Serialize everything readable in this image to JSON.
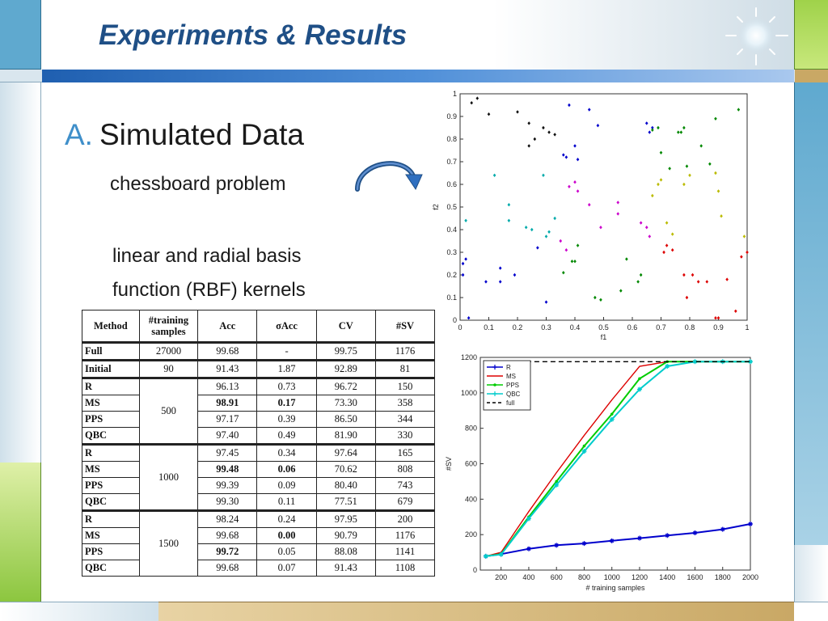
{
  "slide": {
    "title": "Experiments & Results",
    "heading_letter": "A.",
    "heading": "Simulated Data",
    "subtitle1": "chessboard problem",
    "subtitle2_line1": "linear and radial basis",
    "subtitle2_line2": "function (RBF) kernels"
  },
  "colors": {
    "title": "#1f4f86",
    "accent_blue": "#3f8fca",
    "frame_teal": "#5fa9cf",
    "frame_green": "#8cc63f",
    "frame_tan": "#c9a865"
  },
  "table": {
    "headers": [
      "Method",
      "#training samples",
      "Acc",
      "σAcc",
      "CV",
      "#SV"
    ],
    "top_rows": [
      {
        "method": "Full",
        "samples": "27000",
        "acc": "99.68",
        "sigma": "-",
        "cv": "99.75",
        "sv": "1176"
      },
      {
        "method": "Initial",
        "samples": "90",
        "acc": "91.43",
        "sigma": "1.87",
        "cv": "92.89",
        "sv": "81"
      }
    ],
    "groups": [
      {
        "samples": "500",
        "rows": [
          {
            "method": "R",
            "acc": "96.13",
            "sigma": "0.73",
            "cv": "96.72",
            "sv": "150"
          },
          {
            "method": "MS",
            "acc": "98.91",
            "sigma": "0.17",
            "cv": "73.30",
            "sv": "358"
          },
          {
            "method": "PPS",
            "acc": "97.17",
            "sigma": "0.39",
            "cv": "86.50",
            "sv": "344"
          },
          {
            "method": "QBC",
            "acc": "97.40",
            "sigma": "0.49",
            "cv": "81.90",
            "sv": "330"
          }
        ]
      },
      {
        "samples": "1000",
        "rows": [
          {
            "method": "R",
            "acc": "97.45",
            "sigma": "0.34",
            "cv": "97.64",
            "sv": "165"
          },
          {
            "method": "MS",
            "acc": "99.48",
            "sigma": "0.06",
            "cv": "70.62",
            "sv": "808"
          },
          {
            "method": "PPS",
            "acc": "99.39",
            "sigma": "0.09",
            "cv": "80.40",
            "sv": "743"
          },
          {
            "method": "QBC",
            "acc": "99.30",
            "sigma": "0.11",
            "cv": "77.51",
            "sv": "679"
          }
        ]
      },
      {
        "samples": "1500",
        "rows": [
          {
            "method": "R",
            "acc": "98.24",
            "sigma": "0.24",
            "cv": "97.95",
            "sv": "200"
          },
          {
            "method": "MS",
            "acc": "99.68",
            "sigma": "0.00",
            "cv": "90.79",
            "sv": "1176"
          },
          {
            "method": "PPS",
            "acc": "99.72",
            "sigma": "0.05",
            "cv": "88.08",
            "sv": "1141"
          },
          {
            "method": "QBC",
            "acc": "99.68",
            "sigma": "0.07",
            "cv": "91.43",
            "sv": "1108"
          }
        ]
      }
    ]
  },
  "chart_data": [
    {
      "type": "scatter",
      "xlabel": "f1",
      "ylabel": "f2",
      "xlim": [
        0,
        1
      ],
      "ylim": [
        0,
        1
      ],
      "xticks": [
        "0",
        "0.1",
        "0.2",
        "0.3",
        "0.4",
        "0.5",
        "0.6",
        "0.7",
        "0.8",
        "0.9",
        "1"
      ],
      "yticks": [
        "0",
        "0.1",
        "0.2",
        "0.3",
        "0.4",
        "0.5",
        "0.6",
        "0.7",
        "0.8",
        "0.9",
        "1"
      ],
      "series": [
        {
          "color": "#111111",
          "points": [
            [
              0.04,
              0.96
            ],
            [
              0.06,
              0.98
            ],
            [
              0.1,
              0.91
            ],
            [
              0.2,
              0.92
            ],
            [
              0.24,
              0.87
            ],
            [
              0.26,
              0.8
            ],
            [
              0.24,
              0.77
            ],
            [
              0.29,
              0.85
            ],
            [
              0.31,
              0.83
            ],
            [
              0.33,
              0.82
            ]
          ]
        },
        {
          "color": "#0000cc",
          "points": [
            [
              0.01,
              0.2
            ],
            [
              0.02,
              0.27
            ],
            [
              0.01,
              0.25
            ],
            [
              0.03,
              0.01
            ],
            [
              0.09,
              0.17
            ],
            [
              0.14,
              0.23
            ],
            [
              0.14,
              0.17
            ],
            [
              0.19,
              0.2
            ],
            [
              0.27,
              0.32
            ],
            [
              0.3,
              0.08
            ],
            [
              0.36,
              0.73
            ],
            [
              0.37,
              0.72
            ],
            [
              0.38,
              0.95
            ],
            [
              0.4,
              0.77
            ],
            [
              0.41,
              0.71
            ],
            [
              0.45,
              0.93
            ],
            [
              0.48,
              0.86
            ],
            [
              0.65,
              0.87
            ],
            [
              0.66,
              0.83
            ],
            [
              0.67,
              0.85
            ]
          ]
        },
        {
          "color": "#00aaaa",
          "points": [
            [
              0.02,
              0.44
            ],
            [
              0.12,
              0.64
            ],
            [
              0.17,
              0.44
            ],
            [
              0.17,
              0.51
            ],
            [
              0.23,
              0.41
            ],
            [
              0.25,
              0.4
            ],
            [
              0.29,
              0.64
            ],
            [
              0.3,
              0.37
            ],
            [
              0.31,
              0.39
            ],
            [
              0.33,
              0.45
            ]
          ]
        },
        {
          "color": "#cc00cc",
          "points": [
            [
              0.35,
              0.35
            ],
            [
              0.37,
              0.31
            ],
            [
              0.38,
              0.59
            ],
            [
              0.4,
              0.61
            ],
            [
              0.41,
              0.57
            ],
            [
              0.45,
              0.51
            ],
            [
              0.49,
              0.41
            ],
            [
              0.55,
              0.52
            ],
            [
              0.55,
              0.47
            ],
            [
              0.63,
              0.43
            ],
            [
              0.65,
              0.41
            ],
            [
              0.66,
              0.37
            ]
          ]
        },
        {
          "color": "#008800",
          "points": [
            [
              0.36,
              0.21
            ],
            [
              0.39,
              0.26
            ],
            [
              0.4,
              0.26
            ],
            [
              0.41,
              0.33
            ],
            [
              0.47,
              0.1
            ],
            [
              0.49,
              0.09
            ],
            [
              0.56,
              0.13
            ],
            [
              0.58,
              0.27
            ],
            [
              0.62,
              0.17
            ],
            [
              0.63,
              0.2
            ],
            [
              0.67,
              0.84
            ],
            [
              0.69,
              0.85
            ],
            [
              0.7,
              0.74
            ],
            [
              0.73,
              0.67
            ],
            [
              0.76,
              0.83
            ],
            [
              0.77,
              0.83
            ],
            [
              0.78,
              0.85
            ],
            [
              0.79,
              0.68
            ],
            [
              0.84,
              0.77
            ],
            [
              0.87,
              0.69
            ],
            [
              0.89,
              0.89
            ],
            [
              0.97,
              0.93
            ]
          ]
        },
        {
          "color": "#bbbb00",
          "points": [
            [
              0.67,
              0.55
            ],
            [
              0.69,
              0.6
            ],
            [
              0.7,
              0.62
            ],
            [
              0.72,
              0.43
            ],
            [
              0.74,
              0.38
            ],
            [
              0.78,
              0.6
            ],
            [
              0.8,
              0.64
            ],
            [
              0.89,
              0.65
            ],
            [
              0.9,
              0.57
            ],
            [
              0.91,
              0.46
            ],
            [
              0.99,
              0.37
            ]
          ]
        },
        {
          "color": "#dd0000",
          "points": [
            [
              0.71,
              0.3
            ],
            [
              0.72,
              0.33
            ],
            [
              0.74,
              0.31
            ],
            [
              0.78,
              0.2
            ],
            [
              0.79,
              0.1
            ],
            [
              0.81,
              0.2
            ],
            [
              0.83,
              0.17
            ],
            [
              0.86,
              0.17
            ],
            [
              0.89,
              0.01
            ],
            [
              0.9,
              0.01
            ],
            [
              0.93,
              0.18
            ],
            [
              0.96,
              0.04
            ],
            [
              0.98,
              0.28
            ],
            [
              1.0,
              0.3
            ]
          ]
        }
      ]
    },
    {
      "type": "line",
      "xlabel": "# training samples",
      "ylabel": "#SV",
      "xlim": [
        0,
        2000
      ],
      "ylim": [
        0,
        1200
      ],
      "xticks": [
        "200",
        "400",
        "600",
        "800",
        "1000",
        "1200",
        "1400",
        "1600",
        "1800",
        "2000"
      ],
      "yticks": [
        "0",
        "200",
        "400",
        "600",
        "800",
        "1000",
        "1200"
      ],
      "legend_position": "top-left",
      "series": [
        {
          "name": "R",
          "color": "#0000cc",
          "marker": "star",
          "points": [
            [
              90,
              78
            ],
            [
              200,
              90
            ],
            [
              400,
              120
            ],
            [
              600,
              140
            ],
            [
              800,
              150
            ],
            [
              1000,
              165
            ],
            [
              1200,
              180
            ],
            [
              1400,
              195
            ],
            [
              1600,
              210
            ],
            [
              1800,
              230
            ],
            [
              2000,
              260
            ]
          ]
        },
        {
          "name": "MS",
          "color": "#dd0000",
          "marker": "none",
          "points": [
            [
              90,
              78
            ],
            [
              200,
              100
            ],
            [
              400,
              330
            ],
            [
              600,
              550
            ],
            [
              800,
              760
            ],
            [
              1000,
              960
            ],
            [
              1200,
              1150
            ],
            [
              1400,
              1176
            ],
            [
              1600,
              1176
            ],
            [
              1800,
              1176
            ],
            [
              2000,
              1176
            ]
          ]
        },
        {
          "name": "PPS",
          "color": "#00cc00",
          "marker": "dot",
          "points": [
            [
              90,
              78
            ],
            [
              200,
              90
            ],
            [
              400,
              300
            ],
            [
              600,
              500
            ],
            [
              800,
              700
            ],
            [
              1000,
              880
            ],
            [
              1200,
              1080
            ],
            [
              1400,
              1176
            ],
            [
              1600,
              1176
            ],
            [
              1800,
              1176
            ],
            [
              2000,
              1176
            ]
          ]
        },
        {
          "name": "QBC",
          "color": "#00cccc",
          "marker": "star",
          "points": [
            [
              90,
              78
            ],
            [
              200,
              88
            ],
            [
              400,
              290
            ],
            [
              600,
              480
            ],
            [
              800,
              670
            ],
            [
              1000,
              850
            ],
            [
              1200,
              1020
            ],
            [
              1400,
              1150
            ],
            [
              1600,
              1176
            ],
            [
              1800,
              1176
            ],
            [
              2000,
              1176
            ]
          ]
        },
        {
          "name": "full",
          "color": "#000000",
          "marker": "none",
          "dashed": true,
          "points": [
            [
              90,
              1176
            ],
            [
              2000,
              1176
            ]
          ]
        }
      ]
    }
  ]
}
